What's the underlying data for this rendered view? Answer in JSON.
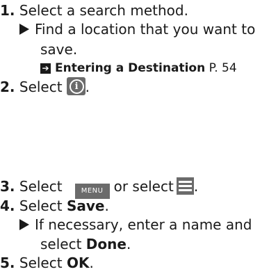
{
  "steps": [
    {
      "num": "1.",
      "text": "Select a search method."
    },
    {
      "num": "2.",
      "text": "Select",
      "after_icon": "."
    },
    {
      "num": "3.",
      "text_before": "Select",
      "menu_label": "MENU",
      "text_mid": "or select",
      "after_icon": "."
    },
    {
      "num": "4.",
      "text": "Select",
      "bold": "Save",
      "after": "."
    },
    {
      "num": "5.",
      "text": "Select",
      "bold": "OK",
      "after": "."
    }
  ],
  "substep1": {
    "line1": "Find a location that you want to",
    "line2": "save."
  },
  "xref": {
    "title": "Entering a Destination",
    "page": "P. 54"
  },
  "substep4": {
    "line1": "If necessary, enter a name and",
    "line2_prefix": "select",
    "line2_bold": "Done",
    "line2_suffix": "."
  },
  "icons": {
    "info": "i",
    "xref": "arrow-right-box-icon",
    "hamburger": "hamburger-menu-icon"
  }
}
